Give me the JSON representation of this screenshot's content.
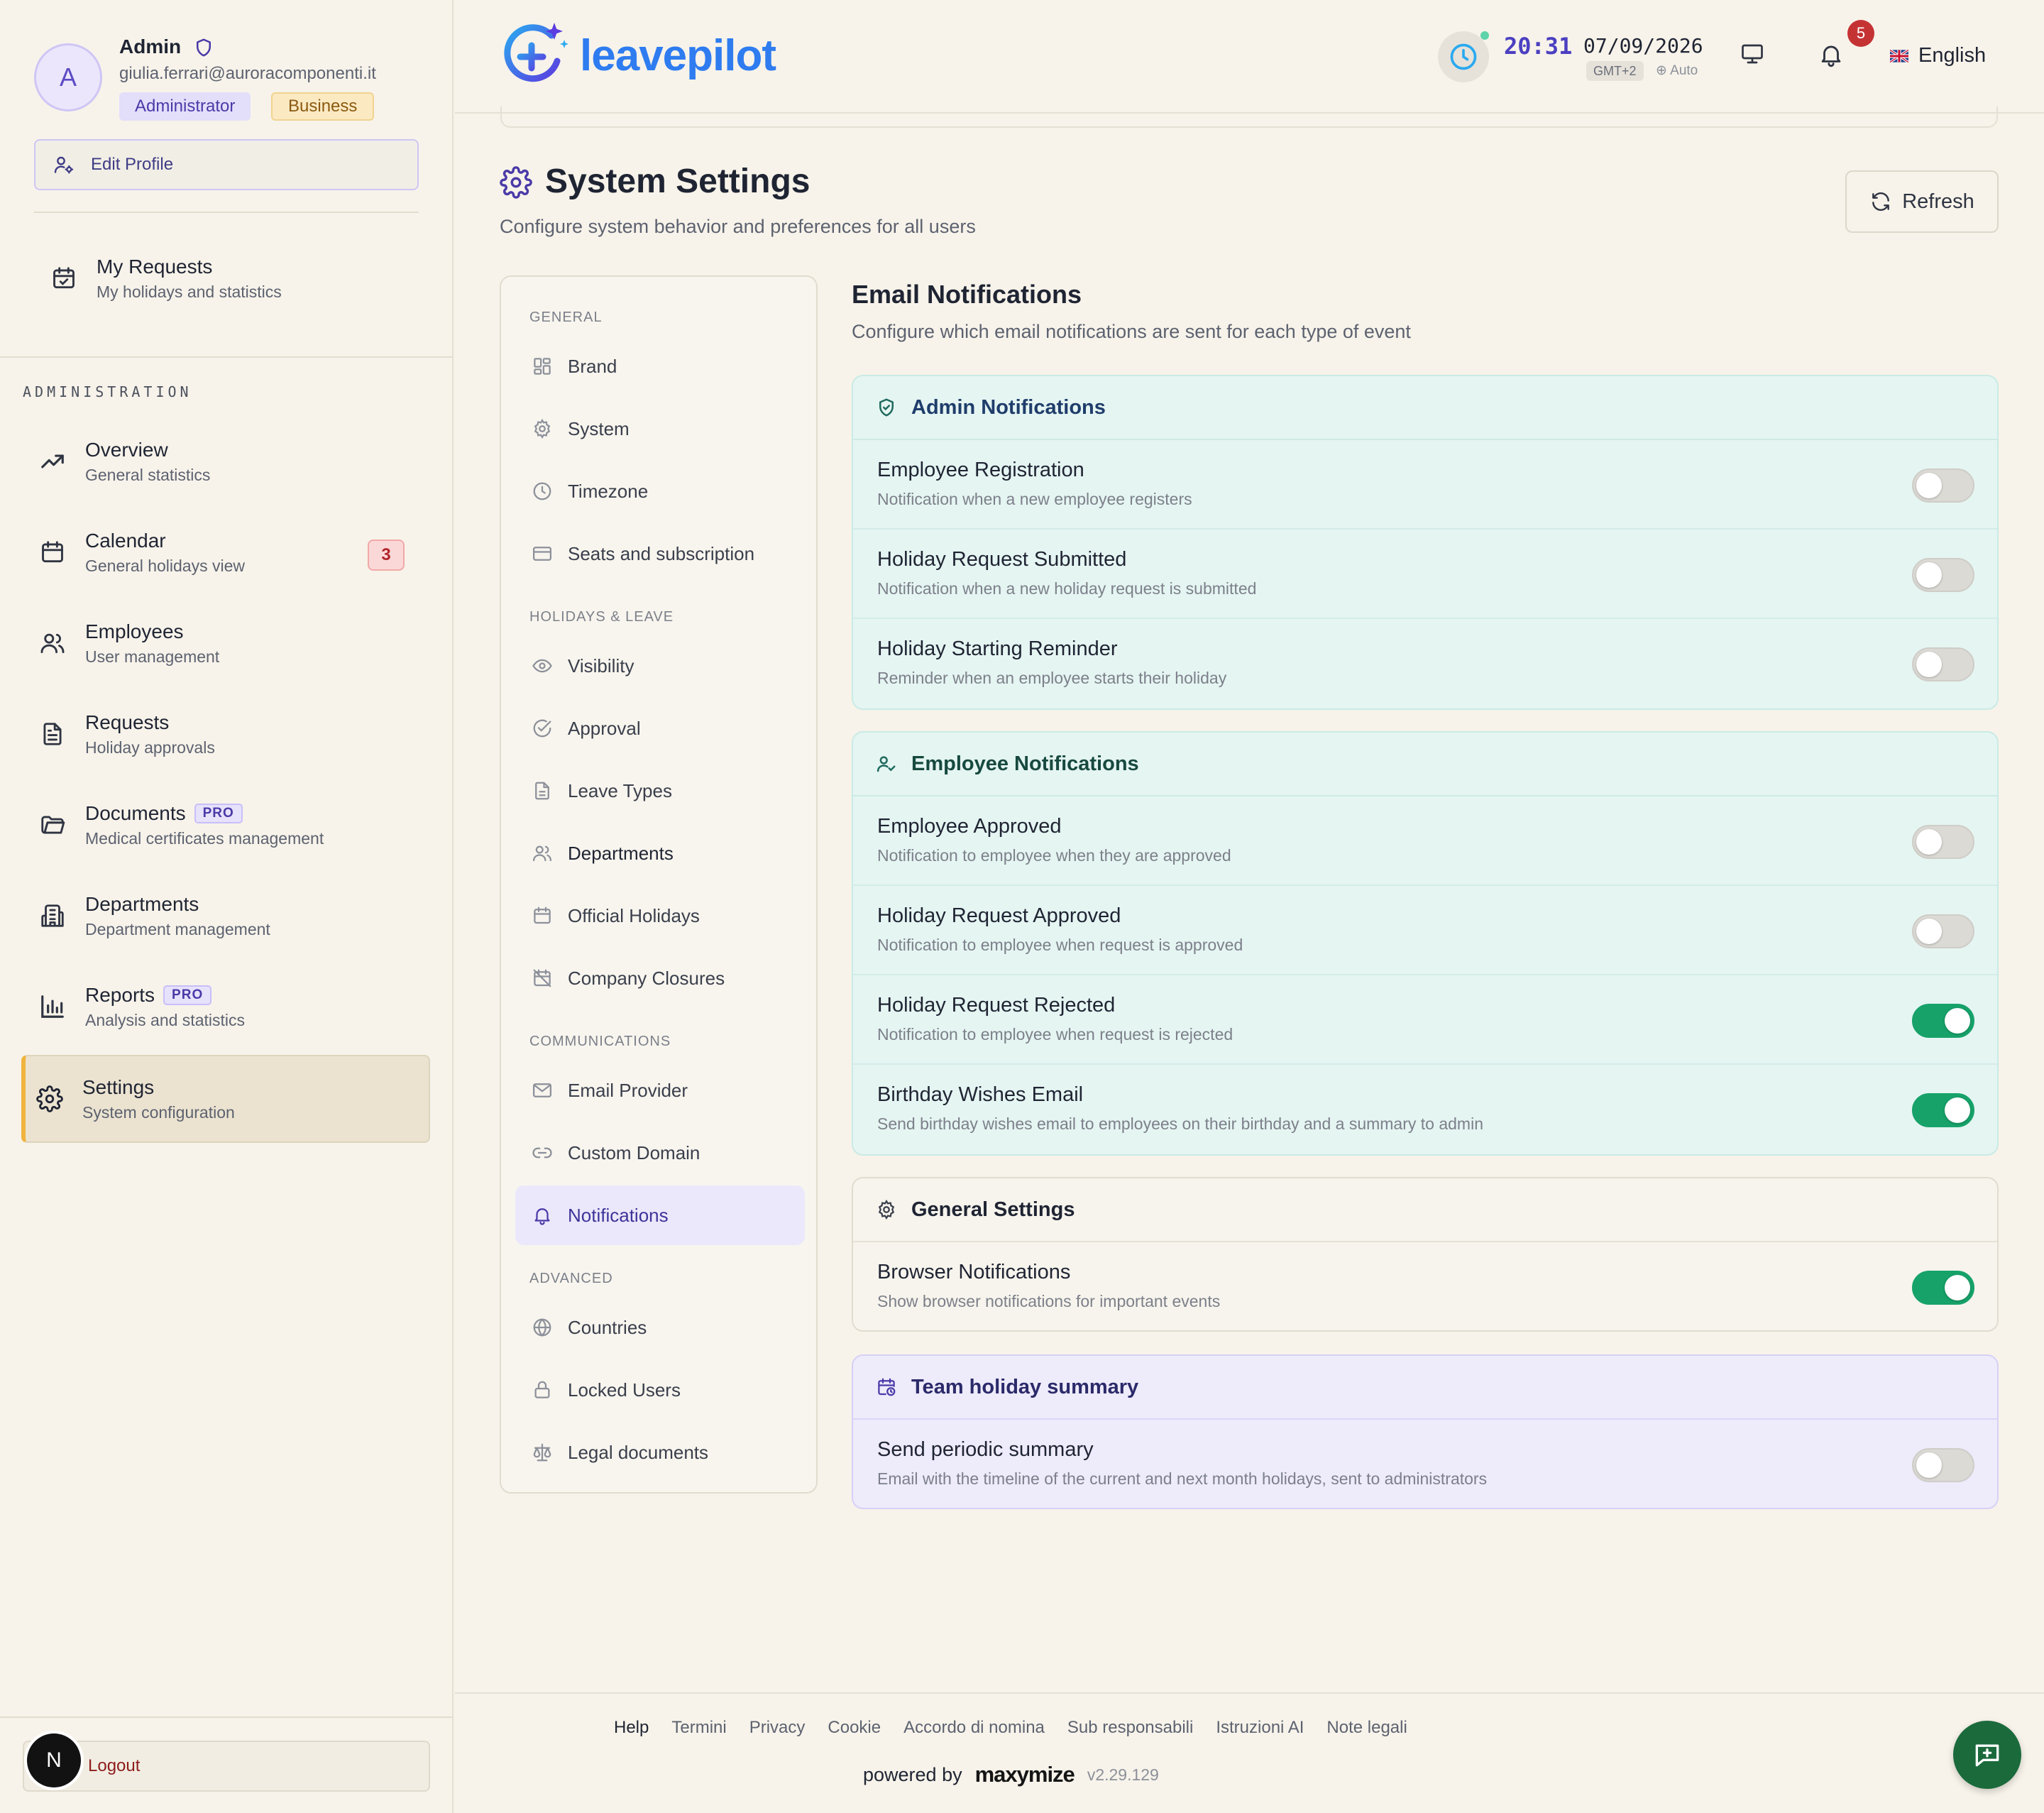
{
  "user": {
    "avatar_initial": "A",
    "name": "Admin",
    "email": "giulia.ferrari@auroracomponenti.it",
    "role_badge": "Administrator",
    "plan_badge": "Business",
    "edit_profile_label": "Edit Profile"
  },
  "my_requests": {
    "title": "My Requests",
    "subtitle": "My holidays and statistics"
  },
  "sidebar": {
    "section_label": "ADMINISTRATION",
    "items": [
      {
        "title": "Overview",
        "subtitle": "General statistics",
        "icon": "trending-up-icon"
      },
      {
        "title": "Calendar",
        "subtitle": "General holidays view",
        "icon": "calendar-icon",
        "count": "3"
      },
      {
        "title": "Employees",
        "subtitle": "User management",
        "icon": "users-icon"
      },
      {
        "title": "Requests",
        "subtitle": "Holiday approvals",
        "icon": "file-text-icon"
      },
      {
        "title": "Documents",
        "subtitle": "Medical certificates management",
        "icon": "folder-icon",
        "badge": "PRO"
      },
      {
        "title": "Departments",
        "subtitle": "Department management",
        "icon": "building-icon"
      },
      {
        "title": "Reports",
        "subtitle": "Analysis and statistics",
        "icon": "bar-chart-icon",
        "badge": "PRO"
      },
      {
        "title": "Settings",
        "subtitle": "System configuration",
        "icon": "gear-icon",
        "active": true
      }
    ],
    "logout_label": "Logout",
    "n_button": "N"
  },
  "header": {
    "brand": "leavepilot",
    "time": "20:31",
    "date": "07/09/2026",
    "timezone": "GMT+2",
    "tz_mode": "Auto",
    "notification_count": "5",
    "language": "English"
  },
  "page": {
    "title": "System Settings",
    "subtitle": "Configure system behavior and preferences for all users",
    "refresh_label": "Refresh"
  },
  "settings_nav": {
    "groups": [
      {
        "label": "GENERAL",
        "items": [
          "Brand",
          "System",
          "Timezone",
          "Seats and subscription"
        ]
      },
      {
        "label": "HOLIDAYS & LEAVE",
        "items": [
          "Visibility",
          "Approval",
          "Leave Types",
          "Departments",
          "Official Holidays",
          "Company Closures"
        ]
      },
      {
        "label": "COMMUNICATIONS",
        "items": [
          "Email Provider",
          "Custom Domain",
          "Notifications"
        ]
      },
      {
        "label": "ADVANCED",
        "items": [
          "Countries",
          "Locked Users",
          "Legal documents"
        ]
      }
    ],
    "active_item": "Notifications"
  },
  "content": {
    "title": "Email Notifications",
    "subtitle": "Configure which email notifications are sent for each type of event",
    "sections": [
      {
        "title": "Admin Notifications",
        "rows": [
          {
            "title": "Employee Registration",
            "desc": "Notification when a new employee registers",
            "enabled": false
          },
          {
            "title": "Holiday Request Submitted",
            "desc": "Notification when a new holiday request is submitted",
            "enabled": false
          },
          {
            "title": "Holiday Starting Reminder",
            "desc": "Reminder when an employee starts their holiday",
            "enabled": false
          }
        ]
      },
      {
        "title": "Employee Notifications",
        "rows": [
          {
            "title": "Employee Approved",
            "desc": "Notification to employee when they are approved",
            "enabled": false
          },
          {
            "title": "Holiday Request Approved",
            "desc": "Notification to employee when request is approved",
            "enabled": false
          },
          {
            "title": "Holiday Request Rejected",
            "desc": "Notification to employee when request is rejected",
            "enabled": true
          },
          {
            "title": "Birthday Wishes Email",
            "desc": "Send birthday wishes email to employees on their birthday and a summary to admin",
            "enabled": true
          }
        ]
      },
      {
        "title": "General Settings",
        "rows": [
          {
            "title": "Browser Notifications",
            "desc": "Show browser notifications for important events",
            "enabled": true
          }
        ]
      },
      {
        "title": "Team holiday summary",
        "rows": [
          {
            "title": "Send periodic summary",
            "desc": "Email with the timeline of the current and next month holidays, sent to administrators",
            "enabled": false
          }
        ]
      }
    ]
  },
  "footer": {
    "links": [
      "Help",
      "Termini",
      "Privacy",
      "Cookie",
      "Accordo di nomina",
      "Sub responsabili",
      "Istruzioni AI",
      "Note legali"
    ],
    "powered_by": "powered by",
    "powered_brand": "maxymize",
    "version": "v2.29.129"
  },
  "colors": {
    "accent": "#4a3aa8",
    "toggle_on": "#17a26a",
    "brand_blue": "#2f7cf0",
    "active_border": "#f0b43c",
    "background": "#f7f3ea"
  }
}
